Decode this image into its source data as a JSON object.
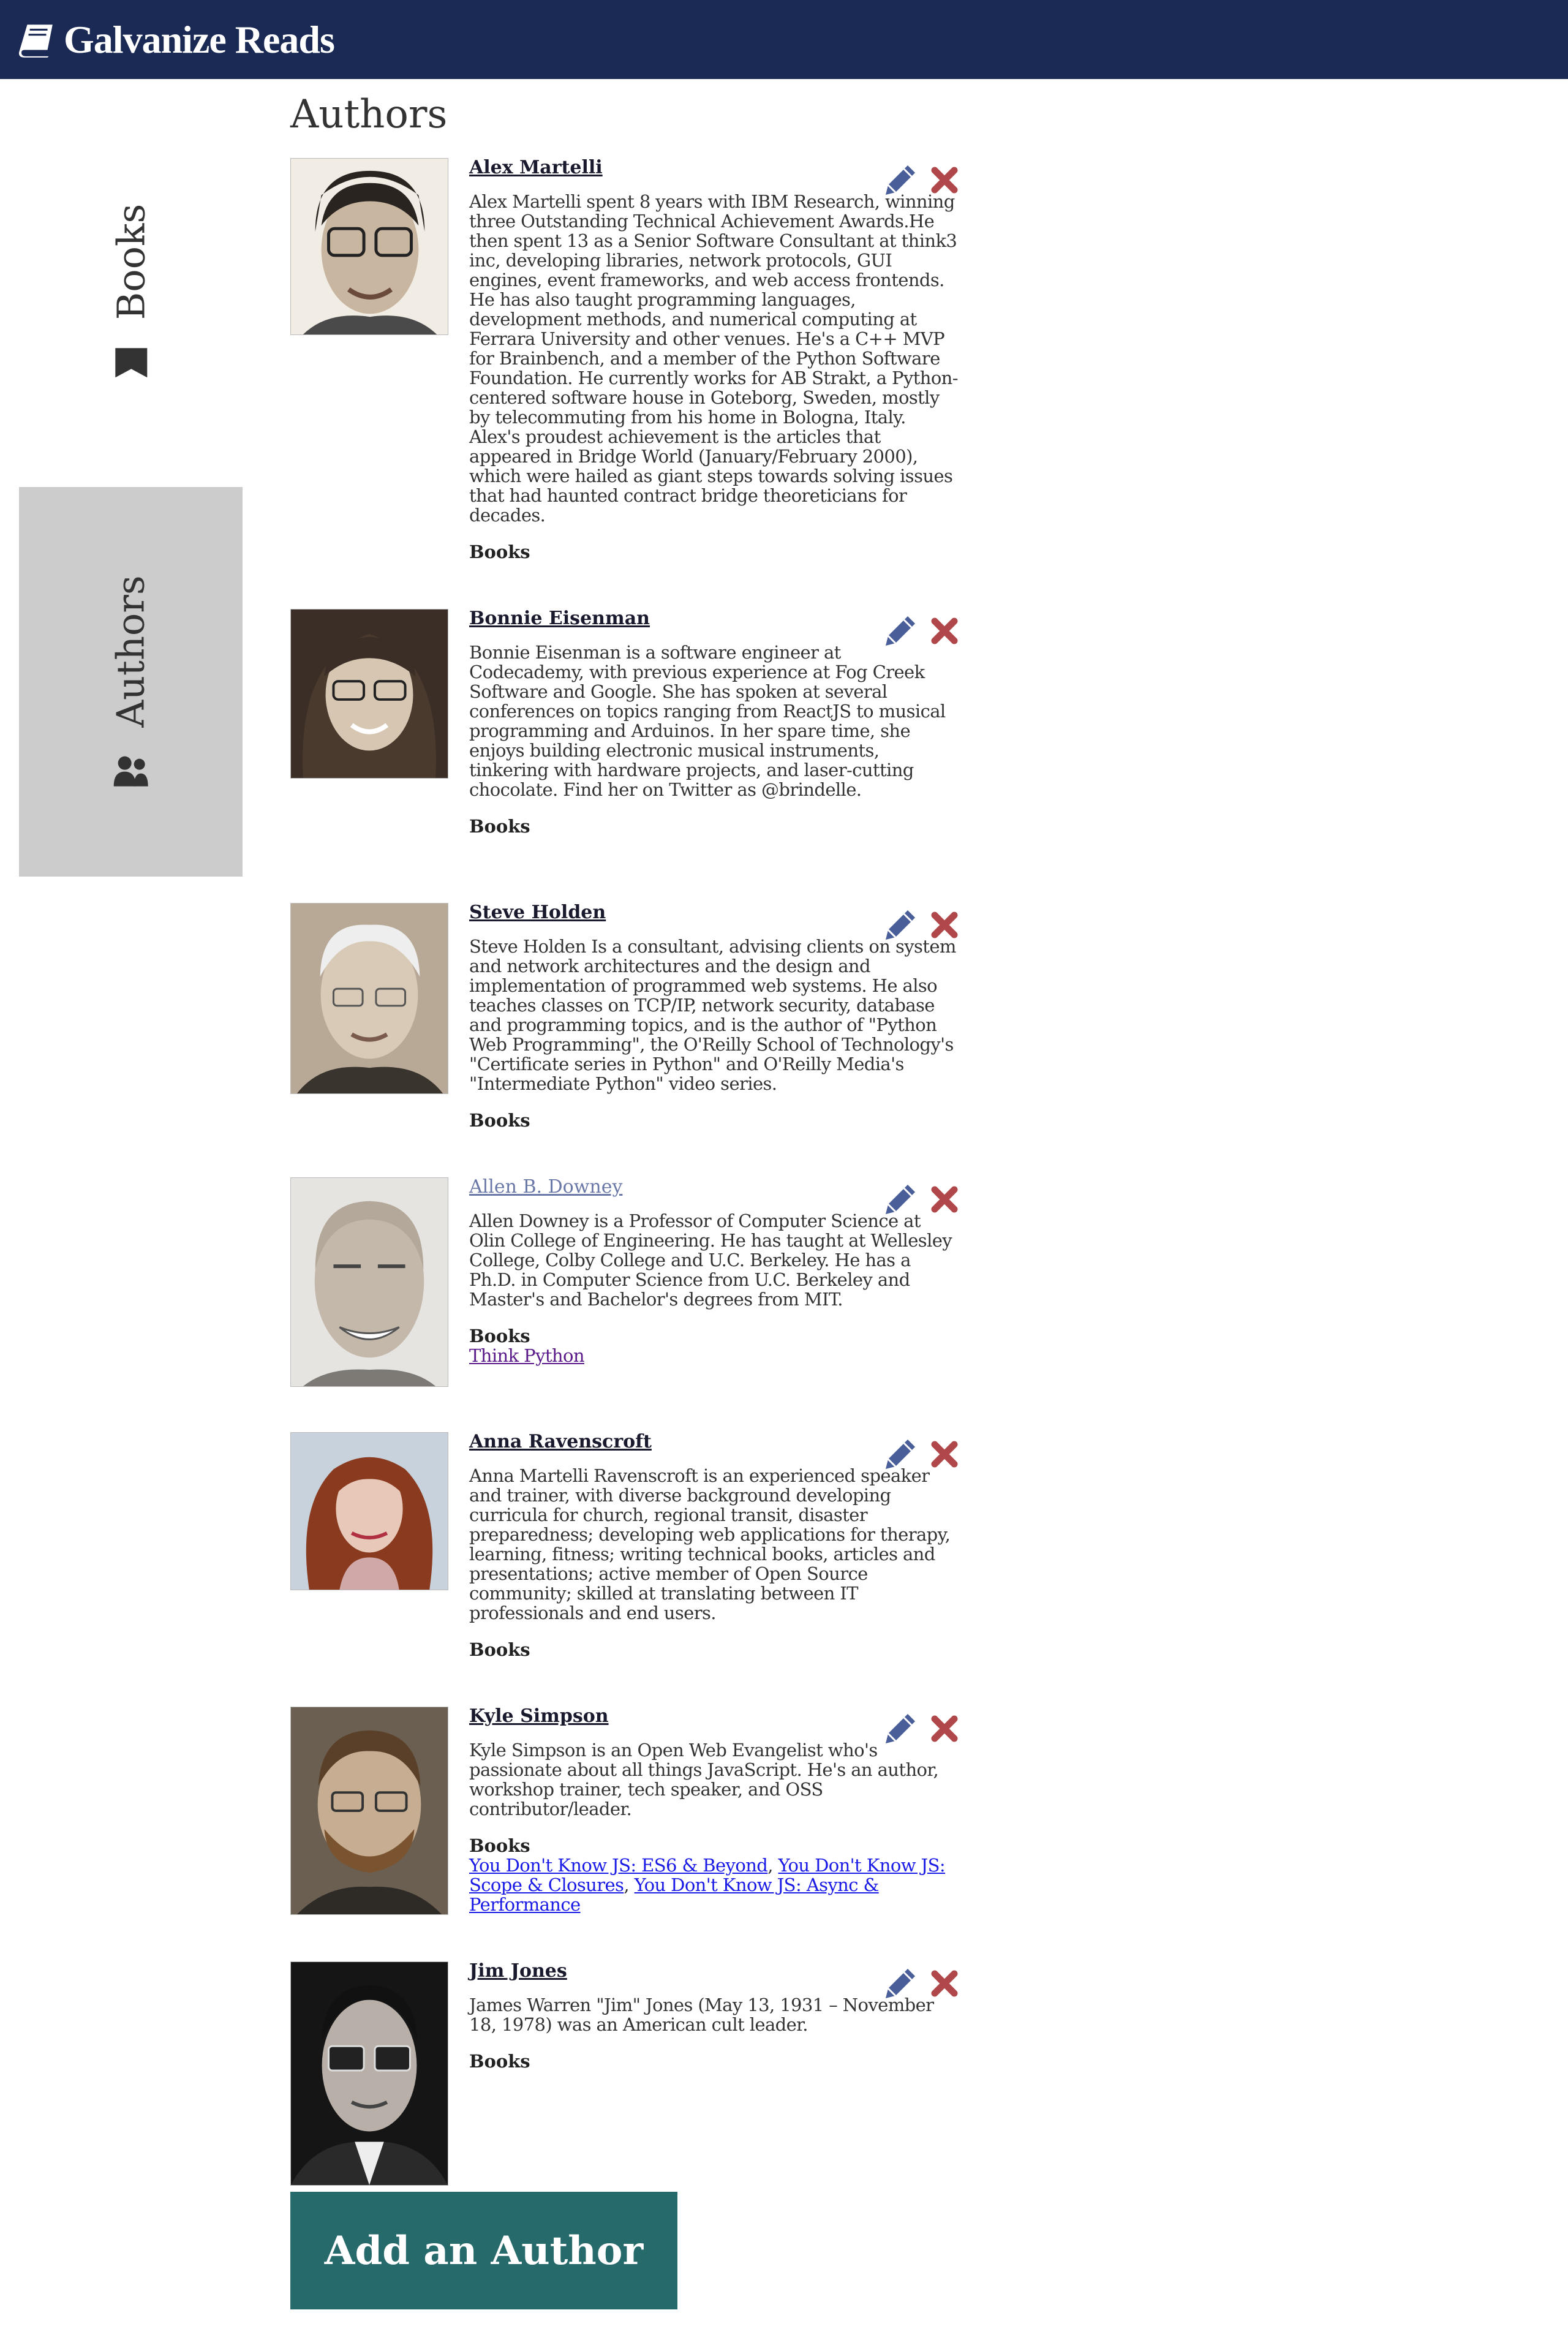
{
  "app": {
    "title": "Galvanize Reads"
  },
  "sidebar": {
    "items": [
      {
        "label": "Books",
        "icon": "bookmark-icon",
        "active": false
      },
      {
        "label": "Authors",
        "icon": "users-icon",
        "active": true
      }
    ]
  },
  "main": {
    "title": "Authors",
    "add_button_label": "Add an Author",
    "books_label": "Books",
    "authors": [
      {
        "name": "Alex Martelli",
        "bio": "Alex Martelli spent 8 years with IBM Research, winning three Outstanding Technical Achievement Awards.He then spent 13 as a Senior Software Consultant at think3 inc, developing libraries, network protocols, GUI engines, event frameworks, and web access frontends. He has also taught programming languages, development methods, and numerical computing at Ferrara University and other venues. He's a C++ MVP for Brainbench, and a member of the Python Software Foundation. He currently works for AB Strakt, a Python-centered software house in Goteborg, Sweden, mostly by telecommuting from his home in Bologna, Italy. Alex's proudest achievement is the articles that appeared in Bridge World (January/February 2000), which were hailed as giant steps towards solving issues that had haunted contract bridge theoreticians for decades.",
        "books": []
      },
      {
        "name": "Bonnie Eisenman",
        "bio": "Bonnie Eisenman is a software engineer at Codecademy, with previous experience at Fog Creek Software and Google. She has spoken at several conferences on topics ranging from ReactJS to musical programming and Arduinos. In her spare time, she enjoys building electronic musical instruments, tinkering with hardware projects, and laser-cutting chocolate. Find her on Twitter as @brindelle.",
        "books": []
      },
      {
        "name": "Steve Holden",
        "bio": "Steve Holden Is a consultant, advising clients on system and network architectures and the design and implementation of programmed web systems. He also teaches classes on TCP/IP, network security, database and programming topics, and is the author of \"Python Web Programming\", the O'Reilly School of Technology's \"Certificate series in Python\" and O'Reilly Media's \"Intermediate Python\" video series.",
        "books": []
      },
      {
        "name": "Allen B. Downey",
        "bio": "Allen Downey is a Professor of Computer Science at Olin College of Engineering. He has taught at Wellesley College, Colby College and U.C. Berkeley. He has a Ph.D. in Computer Science from U.C. Berkeley and Master's and Bachelor's degrees from MIT.",
        "books": [
          "Think Python"
        ]
      },
      {
        "name": "Anna Ravenscroft",
        "bio": "Anna Martelli Ravenscroft is an experienced speaker and trainer, with diverse background developing curricula for church, regional transit, disaster preparedness; developing web applications for therapy, learning, fitness; writing technical books, articles and presentations; active member of Open Source community; skilled at translating between IT professionals and end users.",
        "books": []
      },
      {
        "name": "Kyle Simpson",
        "bio": "Kyle Simpson is an Open Web Evangelist who's passionate about all things JavaScript. He's an author, workshop trainer, tech speaker, and OSS contributor/leader.",
        "books": [
          "You Don't Know JS: ES6 & Beyond",
          "You Don't Know JS: Scope & Closures",
          "You Don't Know JS: Async & Performance"
        ]
      },
      {
        "name": "Jim Jones",
        "bio": "James Warren \"Jim\" Jones (May 13, 1931 – November 18, 1978) was an American cult leader.",
        "books": []
      }
    ]
  },
  "colors": {
    "header_bg": "#1b2a55",
    "active_tab_bg": "#cccccc",
    "edit_icon": "#4a5f9a",
    "delete_icon": "#b0474a",
    "add_button_bg": "#266a6b"
  }
}
